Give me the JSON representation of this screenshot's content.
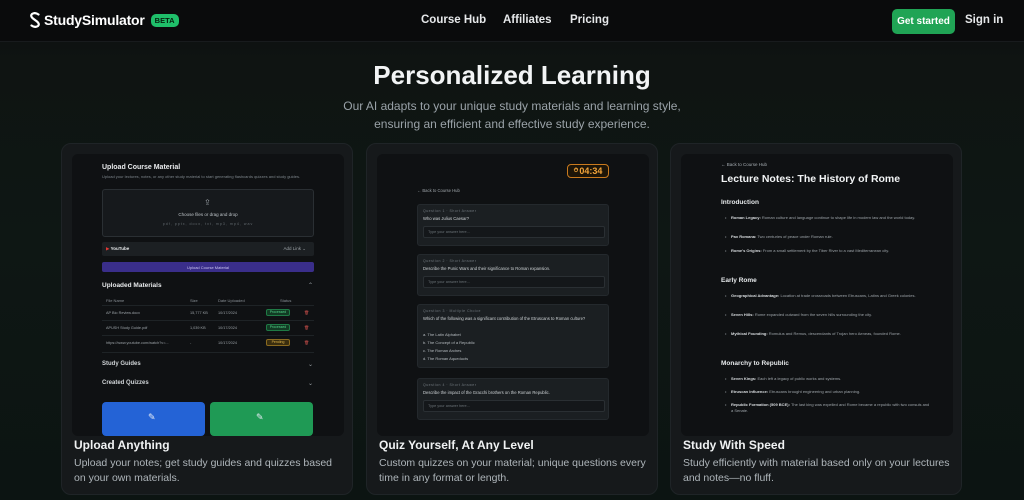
{
  "nav": {
    "brand": "StudySimulator",
    "beta": "BETA",
    "links": [
      "Course Hub",
      "Affiliates",
      "Pricing"
    ],
    "get_started": "Get started",
    "sign_in": "Sign in"
  },
  "hero": {
    "title": "Personalized Learning",
    "subtitle": "Our AI adapts to your unique study materials and learning style, ensuring an efficient and effective study experience."
  },
  "cards": [
    {
      "title": "Upload Anything",
      "desc": "Upload your notes; get study guides and quizzes based on your own materials.",
      "shot": {
        "heading": "Upload Course Material",
        "subheading": "Upload your lectures, notes, or any other study material to start generating flashcards quizzes and study guides.",
        "drop_main": "Choose files or drag and drop",
        "drop_hint": "pdf, pptx, docx, txt, mp3, mp4, wav",
        "yt_brand": "YouTube",
        "yt_add": "Add Link ⌄",
        "upload_btn": "Upload Course Material",
        "uploaded_heading": "Uploaded Materials",
        "cols": [
          "File Name",
          "Size",
          "Date Uploaded",
          "Status"
        ],
        "rows": [
          {
            "name": "AP Bio Review.docx",
            "size": "15,777 KB",
            "date": "10/17/2024",
            "status": "Processed"
          },
          {
            "name": "APUSH Study Guide.pdf",
            "size": "1,039 KB",
            "date": "10/17/2024",
            "status": "Processed"
          },
          {
            "name": "https://www.youtube.com/watch?v=...",
            "size": "-",
            "date": "10/17/2024",
            "status": "Pending"
          }
        ],
        "sections": [
          "Study Guides",
          "Created Quizzes"
        ]
      }
    },
    {
      "title": "Quiz Yourself, At Any Level",
      "desc": "Custom quizzes on your material; unique questions every time in any format or length.",
      "shot": {
        "timer": "04:34",
        "back": "← Back to Course Hub",
        "q1_label": "Question 1 · Short Answer",
        "q1_text": "Who was Julius Caesar?",
        "q2_label": "Question 2 · Short Answer",
        "q2_text": "Describe the Punic Wars and their significance to Roman expansion.",
        "q3_label": "Question 3 · Multiple Choice",
        "q3_text": "Which of the following was a significant contribution of the Etruscans to Roman culture?",
        "q3_opts": [
          "a. The Latin Alphabet",
          "b. The Concept of a Republic",
          "c. The Roman Arches",
          "d. The Roman Aqueducts"
        ],
        "q4_label": "Question 4 · Short Answer",
        "q4_text": "Describe the impact of the Gracchi brothers on the Roman Republic.",
        "answer_placeholder": "Type your answer here..."
      }
    },
    {
      "title": "Study With Speed",
      "desc": "Study efficiently with material based only on your lectures and notes—no fluff.",
      "shot": {
        "back": "← Back to Course Hub",
        "title": "Lecture Notes: The History of Rome",
        "sections": [
          {
            "heading": "Introduction",
            "items": [
              {
                "b": "Roman Legacy:",
                "t": "Roman culture and language continue to shape life in modern law and the world today."
              },
              {
                "b": "Pax Romana:",
                "t": "Two centuries of peace under Roman rule."
              },
              {
                "b": "Rome's Origins:",
                "t": "From a small settlement by the Tiber River to a vast Mediterranean city."
              }
            ]
          },
          {
            "heading": "Early Rome",
            "items": [
              {
                "b": "Geographical Advantage:",
                "t": "Location at trade crossroads between Etruscans, Latins and Greek colonies."
              },
              {
                "b": "Seven Hills:",
                "t": "Rome expanded outward from the seven hills surrounding the city."
              },
              {
                "b": "Mythical Founding:",
                "t": "Romulus and Remus, descendants of Trojan hero Aeneas, founded Rome."
              }
            ]
          },
          {
            "heading": "Monarchy to Republic",
            "items": [
              {
                "b": "Seven Kings:",
                "t": "Each left a legacy of public works and systems."
              },
              {
                "b": "Etruscan Influence:",
                "t": "Etruscans brought engineering and urban planning."
              },
              {
                "b": "Republic Formation (509 BCE):",
                "t": "The last king was expelled and Rome became a republic with two consuls and a Senate."
              }
            ]
          }
        ]
      }
    }
  ],
  "colors": {
    "accent_green": "#20a455",
    "beta_green": "#1fbf6a",
    "timer_orange": "#f3a43a",
    "upload_blue": "#2463d6",
    "upload_purple": "#3a2e8a"
  }
}
